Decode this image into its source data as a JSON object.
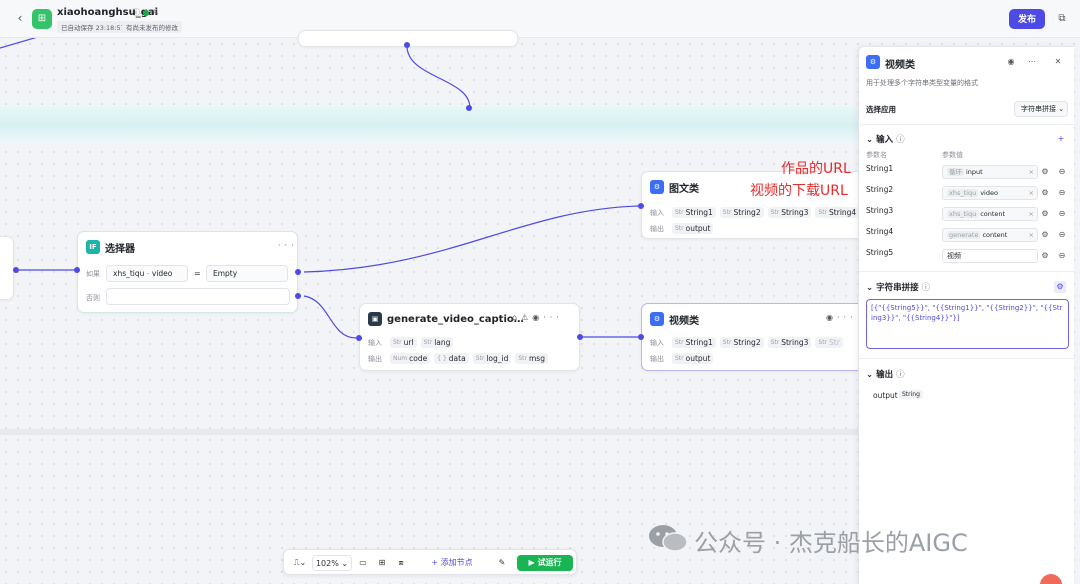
{
  "topbar": {
    "back_icon": "chevron-left-icon",
    "app_name": "xiaohoanghsu_gai",
    "save_status": "已自动保存 23:18:57",
    "unpublished": "有尚未发布的修改",
    "publish_label": "发布"
  },
  "annotations": {
    "line1": "作品的URL",
    "line2": "视频的下载URL"
  },
  "nodes": {
    "tuwen": {
      "title": "图文类",
      "input_label": "输入",
      "inputs": [
        {
          "type": "Str",
          "name": "String1"
        },
        {
          "type": "Str",
          "name": "String2"
        },
        {
          "type": "Str",
          "name": "String3"
        },
        {
          "type": "Str",
          "name": "String4"
        }
      ],
      "output_label": "输出",
      "output": {
        "type": "Str",
        "name": "output"
      }
    },
    "selector": {
      "icon_text": "IF",
      "title": "选择器",
      "if_label": "如果",
      "cond_var_prefix": "xhs_tiqu",
      "cond_var_sep": "-",
      "cond_var_name": "video",
      "cond_op": "=",
      "cond_value": "Empty",
      "else_label": "否则"
    },
    "genvideo": {
      "title": "generate_video_captio…",
      "input_label": "输入",
      "inputs": [
        {
          "type": "Str",
          "name": "url"
        },
        {
          "type": "Str",
          "name": "lang"
        }
      ],
      "output_label": "输出",
      "outputs": [
        {
          "type": "Num",
          "name": "code"
        },
        {
          "type": "{ }",
          "name": "data"
        },
        {
          "type": "Str",
          "name": "log_id"
        },
        {
          "type": "Str",
          "name": "msg"
        }
      ]
    },
    "shipin": {
      "title": "视频类",
      "input_label": "输入",
      "inputs": [
        {
          "type": "Str",
          "name": "String1"
        },
        {
          "type": "Str",
          "name": "String2"
        },
        {
          "type": "Str",
          "name": "String3"
        },
        {
          "type": "Str",
          "name": "Str"
        }
      ],
      "output_label": "输出",
      "output": {
        "type": "Str",
        "name": "output"
      }
    }
  },
  "panel": {
    "title": "视频类",
    "description": "用于处理多个字符串类型变量的格式",
    "select_app_label": "选择应用",
    "select_app_value": "字符串拼接",
    "input_section": "输入",
    "col_name": "参数名",
    "col_value": "参数值",
    "params": [
      {
        "name": "String1",
        "ref_prefix": "循环",
        "ref_name": "input"
      },
      {
        "name": "String2",
        "ref_prefix": "xhs_tiqu",
        "ref_name": "video"
      },
      {
        "name": "String3",
        "ref_prefix": "xhs_tiqu",
        "ref_name": "content"
      },
      {
        "name": "String4",
        "ref_prefix": "generate",
        "ref_name": "content"
      },
      {
        "name": "String5",
        "ref_prefix": "",
        "ref_name": "视频"
      }
    ],
    "concat_section": "字符串拼接",
    "concat_template": "[{\"{{String5}}\", \"{{String1}}\", \"{{String2}}\", \"{{String3}}\", \"{{String4}}\"}]",
    "output_section": "输出",
    "output_name": "output",
    "output_type": "String"
  },
  "toolbar": {
    "zoom": "102%",
    "add_node": "添加节点",
    "run": "试运行"
  },
  "watermark": "公众号 · 杰克船长的AIGC"
}
